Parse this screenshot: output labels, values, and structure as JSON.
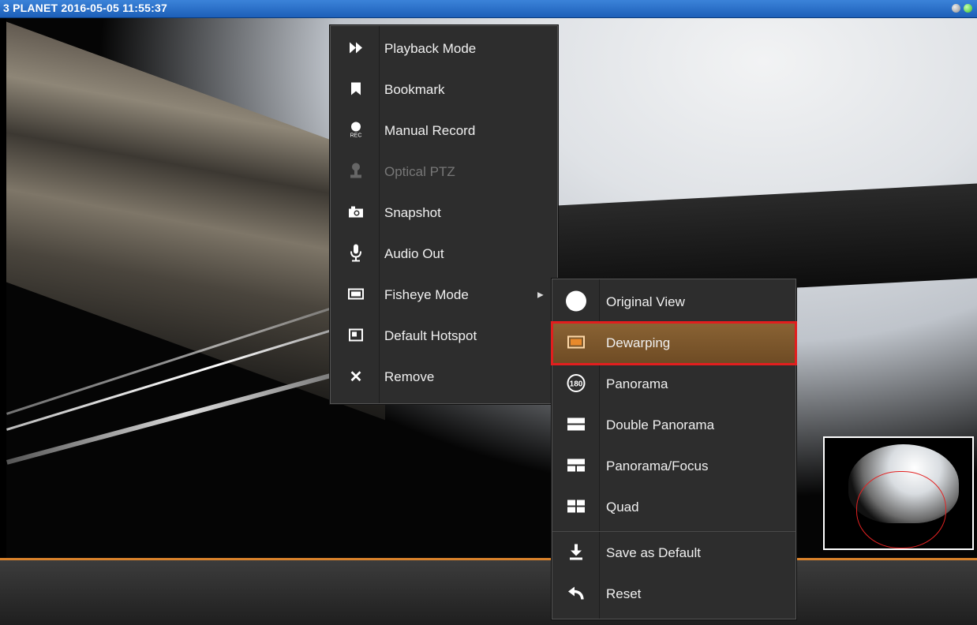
{
  "window": {
    "title": "3 PLANET  2016-05-05 11:55:37",
    "status_lights": [
      "grey",
      "green"
    ]
  },
  "colors": {
    "menu_bg": "#2d2d2d",
    "selected_bg": "#7d5830",
    "selection_outline": "#e21e1e",
    "accent_bar": "#d9822b",
    "title_bar": "#2a6fc9"
  },
  "context_menu": {
    "items": [
      {
        "label": "Playback Mode",
        "icon": "fast-forward-icon",
        "glyph": "⏩"
      },
      {
        "label": "Bookmark",
        "icon": "bookmark-icon",
        "glyph": "🔖"
      },
      {
        "label": "Manual Record",
        "icon": "record-icon",
        "glyph": "●"
      },
      {
        "label": "Optical PTZ",
        "icon": "ptz-joystick-icon",
        "glyph": "♟",
        "disabled": true
      },
      {
        "label": "Snapshot",
        "icon": "camera-icon",
        "glyph": "📷"
      },
      {
        "label": "Audio Out",
        "icon": "microphone-icon",
        "glyph": "🎙"
      },
      {
        "label": "Fisheye Mode",
        "icon": "fisheye-mode-icon",
        "glyph": "▭",
        "has_submenu": true
      },
      {
        "label": "Default Hotspot",
        "icon": "hotspot-icon",
        "glyph": "◧"
      },
      {
        "label": "Remove",
        "icon": "close-icon",
        "glyph": "✕"
      }
    ]
  },
  "fisheye_submenu": {
    "items": [
      {
        "label": "Original View",
        "icon": "circle-icon",
        "glyph": "●"
      },
      {
        "label": "Dewarping",
        "icon": "dewarping-icon",
        "glyph": "▣",
        "selected": true
      },
      {
        "label": "Panorama",
        "icon": "panorama-180-icon",
        "glyph": "180"
      },
      {
        "label": "Double Panorama",
        "icon": "double-panorama-icon",
        "glyph": "☰"
      },
      {
        "label": "Panorama/Focus",
        "icon": "panorama-focus-icon",
        "glyph": "⊟"
      },
      {
        "label": "Quad",
        "icon": "quad-icon",
        "glyph": "⊞"
      },
      {
        "label": "Save as Default",
        "icon": "download-icon",
        "glyph": "⤓"
      },
      {
        "label": "Reset",
        "icon": "undo-icon",
        "glyph": "↶"
      }
    ]
  },
  "rec_label": "REC"
}
